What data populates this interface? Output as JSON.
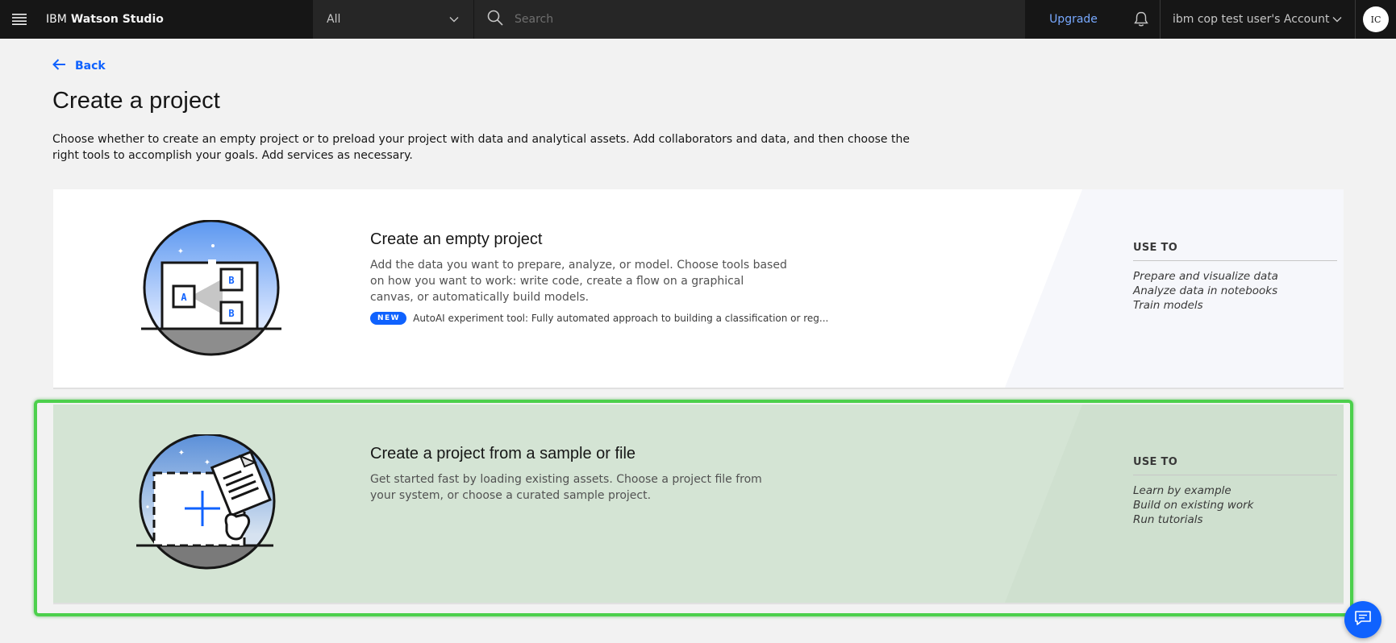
{
  "header": {
    "brand_prefix": "IBM",
    "brand_name": "Watson Studio",
    "scope_value": "All",
    "search_placeholder": "Search",
    "upgrade_label": "Upgrade",
    "account_name": "ibm cop test user's Account",
    "avatar_initials": "IC"
  },
  "page": {
    "back_label": "Back",
    "title": "Create a project",
    "description": "Choose whether to create an empty project or to preload your project with data and analytical assets. Add collaborators and data, and then choose the right tools to accomplish your goals. Add services as necessary."
  },
  "cards": [
    {
      "title": "Create an empty project",
      "description": "Add the data you want to prepare, analyze, or model. Choose tools based on how you want to work: write code, create a flow on a graphical canvas, or automatically build models.",
      "badge": "NEW",
      "badge_text": "AutoAI experiment tool: Fully automated approach to building a classification or reg...",
      "use_to_heading": "USE TO",
      "use_to_items": [
        "Prepare and visualize data",
        "Analyze data in notebooks",
        "Train models"
      ]
    },
    {
      "title": "Create a project from a sample or file",
      "description": "Get started fast by loading existing assets. Choose a project file from your system, or choose a curated sample project.",
      "use_to_heading": "USE TO",
      "use_to_items": [
        "Learn by example",
        "Build on existing work",
        "Run tutorials"
      ]
    }
  ],
  "colors": {
    "accent": "#0f62fe",
    "selection_outline": "#4cd04c",
    "header_bg": "#161616"
  }
}
